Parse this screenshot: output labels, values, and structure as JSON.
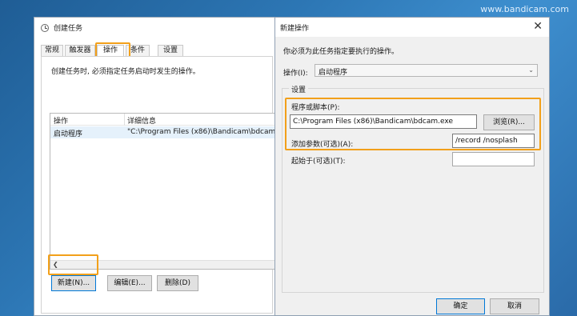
{
  "watermark": "www.bandicam.com",
  "left_window": {
    "title": "创建任务",
    "tabs": [
      "常规",
      "触发器",
      "操作",
      "条件",
      "设置"
    ],
    "description": "创建任务时, 必须指定任务启动时发生的操作。",
    "columns": [
      "操作",
      "详细信息"
    ],
    "rows": [
      {
        "action": "启动程序",
        "details": "\"C:\\Program Files (x86)\\Bandicam\\bdcam."
      }
    ],
    "buttons": {
      "new": "新建(N)...",
      "edit": "编辑(E)...",
      "delete": "删除(D)"
    }
  },
  "right_dialog": {
    "title": "新建操作",
    "prompt": "你必须为此任务指定要执行的操作。",
    "action_label": "操作(I):",
    "action_value": "启动程序",
    "settings_label": "设置",
    "program_label": "程序或脚本(P):",
    "program_value": "C:\\Program Files (x86)\\Bandicam\\bdcam.exe",
    "browse": "浏览(R)...",
    "args_label": "添加参数(可选)(A):",
    "args_value": "/record /nosplash",
    "start_label": "起始于(可选)(T):",
    "start_value": "",
    "ok": "确定",
    "cancel": "取消"
  },
  "highlight_color": "#f2a01a"
}
